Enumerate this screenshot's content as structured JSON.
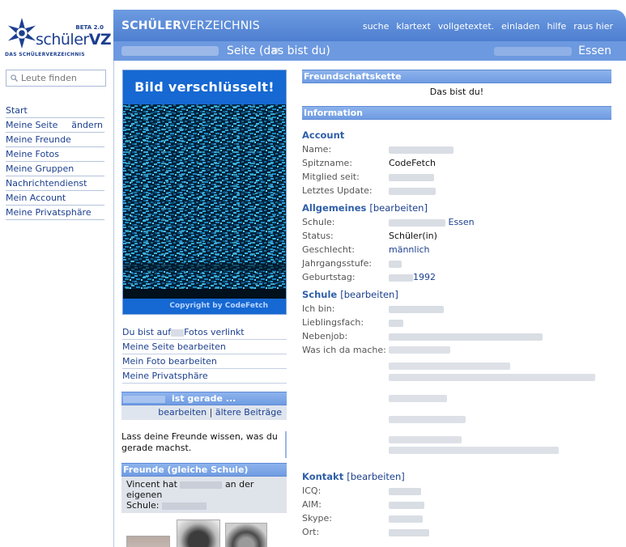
{
  "brand": {
    "beta": "BETA 2.0",
    "word_plain": "schüler",
    "word_bold": "VZ",
    "tagline": "DAS SCHÜLERVERZEICHNIS",
    "colors": {
      "primary": "#1c3f8f",
      "header": "#5d8ad6"
    }
  },
  "sidebar": {
    "search_placeholder": "Leute finden",
    "items": [
      {
        "label": "Start"
      },
      {
        "label": "Meine Seite",
        "extra": "ändern"
      },
      {
        "label": "Meine Freunde"
      },
      {
        "label": "Meine Fotos"
      },
      {
        "label": "Meine Gruppen"
      },
      {
        "label": "Nachrichtendienst"
      },
      {
        "label": "Mein Account"
      },
      {
        "label": "Meine Privatsphäre"
      }
    ]
  },
  "header": {
    "brand_bold": "SCHÜLER",
    "brand_rest": "VERZEICHNIS",
    "menu": [
      "suche",
      "klartext",
      "vollgetextet.",
      "einladen",
      "hilfe",
      "raus hier"
    ],
    "page_title": "Seite (das bist du)",
    "city": "Essen"
  },
  "profile_picture": {
    "banner": "Bild verschlüsselt!",
    "footer": "Copyright by CodeFetch"
  },
  "picture_links": {
    "tagged_prefix": "Du bist auf",
    "tagged_suffix": "Fotos verlinkt",
    "items": [
      "Meine Seite bearbeiten",
      "Mein Foto bearbeiten",
      "Meine Privatsphäre"
    ]
  },
  "status": {
    "head_suffix": "ist gerade ...",
    "edit": "bearbeiten",
    "separator": "|",
    "older": "ältere Beiträge",
    "text": "Lass deine Freunde wissen, was du gerade machst."
  },
  "friends": {
    "head": "Freunde (gleiche Schule)",
    "line1_a": "Vincent hat",
    "line1_b": "an der eigenen",
    "line2": "Schule:"
  },
  "right": {
    "chain_head": "Freundschaftskette",
    "chain_note": "Das bist du!",
    "info_head": "Information",
    "account": {
      "title": "Account",
      "rows": [
        {
          "k": "Name:",
          "v": ""
        },
        {
          "k": "Spitzname:",
          "v": "CodeFetch"
        },
        {
          "k": "Mitglied seit:",
          "v": ""
        },
        {
          "k": "Letztes Update:",
          "v": ""
        }
      ]
    },
    "general": {
      "title": "Allgemeines",
      "edit": "[bearbeiten]",
      "rows": [
        {
          "k": "Schule:",
          "v": "Essen"
        },
        {
          "k": "Status:",
          "v": "Schüler(in)"
        },
        {
          "k": "Geschlecht:",
          "v": "männlich"
        },
        {
          "k": "Jahrgangsstufe:",
          "v": ""
        },
        {
          "k": "Geburtstag:",
          "v": "1992"
        }
      ]
    },
    "school": {
      "title": "Schule",
      "edit": "[bearbeiten]",
      "rows": [
        {
          "k": "Ich bin:"
        },
        {
          "k": "Lieblingsfach:"
        },
        {
          "k": "Nebenjob:"
        },
        {
          "k": "Was ich da mache:"
        }
      ]
    },
    "contact": {
      "title": "Kontakt",
      "edit": "[bearbeiten]",
      "rows": [
        {
          "k": "ICQ:"
        },
        {
          "k": "AIM:"
        },
        {
          "k": "Skype:"
        },
        {
          "k": "Ort:"
        }
      ]
    }
  }
}
